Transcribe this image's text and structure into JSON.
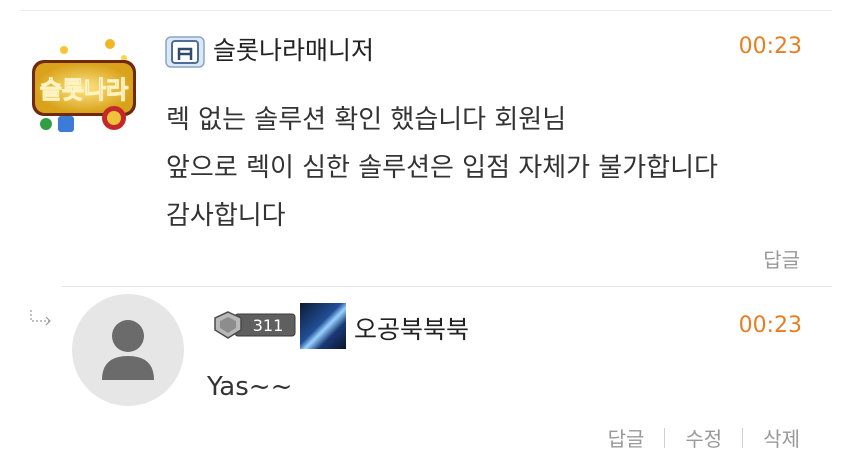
{
  "comment": {
    "author": "슬롯나라매니저",
    "time": "00:23",
    "lines": [
      "렉 없는 솔루션 확인 했습니다 회원님",
      "앞으로 렉이 심한 솔루션은 입점 자체가 불가합니다",
      "감사합니다"
    ],
    "reply_label": "답글",
    "avatar_logo_text": "슬롯나라"
  },
  "reply": {
    "author": "오공북북북",
    "level": "311",
    "time": "00:23",
    "text": "Yas~~",
    "actions": {
      "reply": "답글",
      "edit": "수정",
      "delete": "삭제"
    }
  },
  "colors": {
    "time": "#e67e22",
    "muted": "#999999",
    "avatar_bg": "#e6e6e6"
  }
}
